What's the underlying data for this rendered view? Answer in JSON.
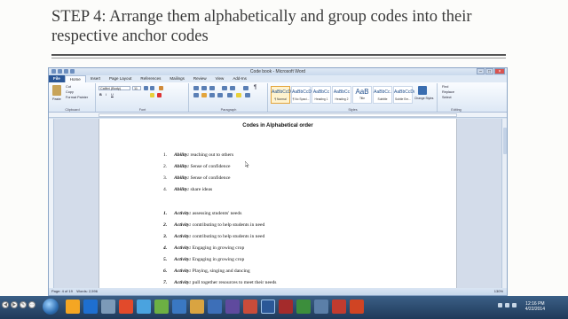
{
  "slide": {
    "title": "STEP 4: Arrange them alphabetically and group codes into their respective anchor codes"
  },
  "word": {
    "window_title": "Code book - Microsoft Word",
    "tabs": [
      "File",
      "Home",
      "Insert",
      "Page Layout",
      "References",
      "Mailings",
      "Review",
      "View",
      "Add-Ins"
    ],
    "active_tab": "Home",
    "clipboard": {
      "paste": "Paste",
      "cut": "Cut",
      "copy": "Copy",
      "format_painter": "Format Painter",
      "group": "Clipboard"
    },
    "font": {
      "name": "Calibri (Body)",
      "size": "11",
      "group": "Font"
    },
    "paragraph": {
      "group": "Paragraph"
    },
    "styles": {
      "group": "Styles",
      "items": [
        {
          "sample": "AaBbCcDc",
          "name": "¶ Normal"
        },
        {
          "sample": "AaBbCcDc",
          "name": "¶ No Spaci..."
        },
        {
          "sample": "AaBbCc",
          "name": "Heading 1"
        },
        {
          "sample": "AaBbCc",
          "name": "Heading 2"
        },
        {
          "sample": "AaB",
          "name": "Title"
        },
        {
          "sample": "AaBbCc.",
          "name": "Subtitle"
        },
        {
          "sample": "AaBbCcDı",
          "name": "Subtle Em..."
        }
      ],
      "change_styles": "Change Styles"
    },
    "editing": {
      "find": "Find",
      "replace": "Replace",
      "select": "Select",
      "group": "Editing"
    },
    "document": {
      "heading": "Codes in Alphabetical order",
      "list_a": [
        {
          "num": "1.",
          "keyword": "Ability:",
          "text": "reaching out to others"
        },
        {
          "num": "2.",
          "keyword": "Ability:",
          "text": "Sense of confidence"
        },
        {
          "num": "3.",
          "keyword": "Ability:",
          "text": "Sense of confidence"
        },
        {
          "num": "4.",
          "keyword": "Ability:",
          "text": "share ideas"
        }
      ],
      "list_b": [
        {
          "num": "1.",
          "keyword": "Activity:",
          "text": "assessing students' needs"
        },
        {
          "num": "2.",
          "keyword": "Activity:",
          "text": "contributing to help students in need"
        },
        {
          "num": "3.",
          "keyword": "Activity:",
          "text": "contributing to help students in need"
        },
        {
          "num": "4.",
          "keyword": "Activity:",
          "text": "Engaging in growing crop"
        },
        {
          "num": "5.",
          "keyword": "Activity:",
          "text": "Engaging in growing crop"
        },
        {
          "num": "6.",
          "keyword": "Activity:",
          "text": "Playing, singing and dancing"
        },
        {
          "num": "7.",
          "keyword": "Activity:",
          "text": "pull together resources to meet their needs"
        }
      ]
    },
    "status": {
      "page": "Page: 4 of 19",
      "words": "Words: 2,596",
      "zoom": "130%"
    }
  },
  "taskbar": {
    "time": "12:16 PM",
    "date": "4/22/2014"
  },
  "slidenav": [
    "◀",
    "▶",
    "✎",
    "⋯"
  ],
  "colors": {
    "file_tab": "#2b5797",
    "taskbar": "#1f3a5a",
    "title_text": "#3a3a3a"
  }
}
